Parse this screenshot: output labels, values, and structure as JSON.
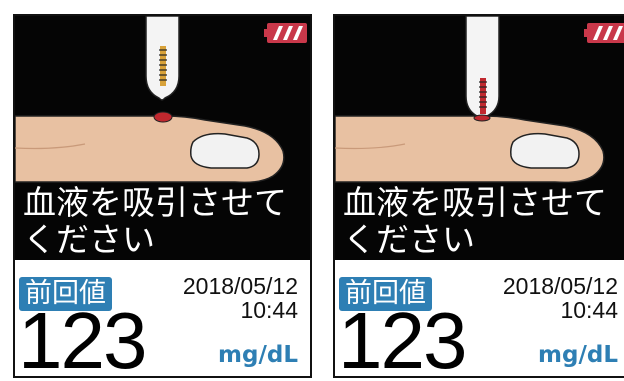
{
  "screens": [
    {
      "instruction": "血液を吸引させてください",
      "last_label": "前回値",
      "date": "2018/05/12",
      "time": "10:44",
      "value": "123",
      "unit": "mg/dL",
      "battery_icon": "battery-full-icon",
      "strip_state": "waiting"
    },
    {
      "instruction": "血液を吸引させてください",
      "last_label": "前回値",
      "date": "2018/05/12",
      "time": "10:44",
      "value": "123",
      "unit": "mg/dL",
      "battery_icon": "battery-full-icon",
      "strip_state": "drawing-blood"
    }
  ],
  "colors": {
    "display_bg": "#050505",
    "accent_blue": "#2e7fb4",
    "battery_red": "#c9384a",
    "blood_red": "#c0282e",
    "skin": "#e8c1a2"
  }
}
